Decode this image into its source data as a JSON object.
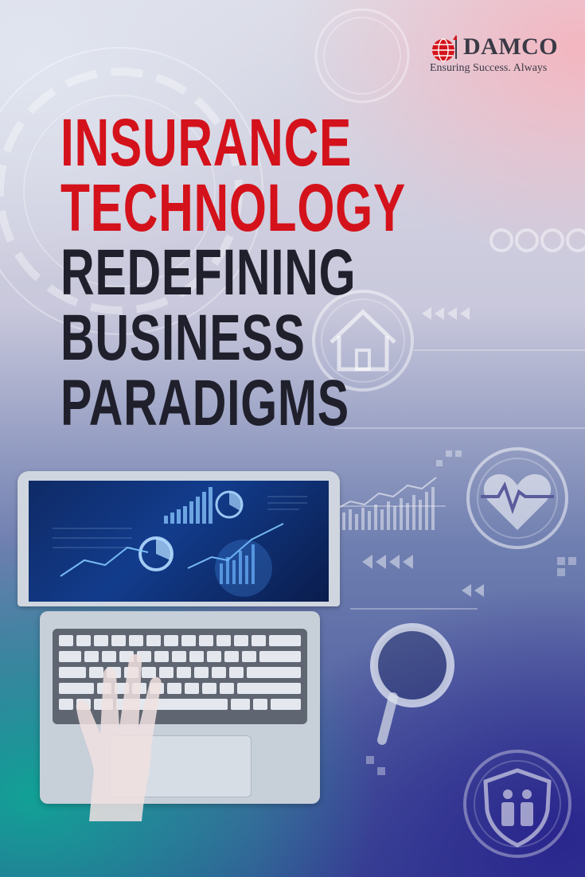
{
  "brand": {
    "name": "DAMCO",
    "tagline": "Ensuring Success. Always",
    "mark_icon": "globe-arrow-icon",
    "accent_color": "#d4121b"
  },
  "headline": {
    "line1": "INSURANCE",
    "line2": "TECHNOLOGY",
    "line3": "REDEFINING",
    "line4": "BUSINESS",
    "line5": "PARADIGMS",
    "highlight_color": "#d4121b",
    "text_color": "#20202c"
  },
  "illustration": {
    "icons": [
      "home-icon",
      "heart-pulse-icon",
      "family-shield-icon",
      "magnifier-icon",
      "laptop-icon"
    ]
  }
}
